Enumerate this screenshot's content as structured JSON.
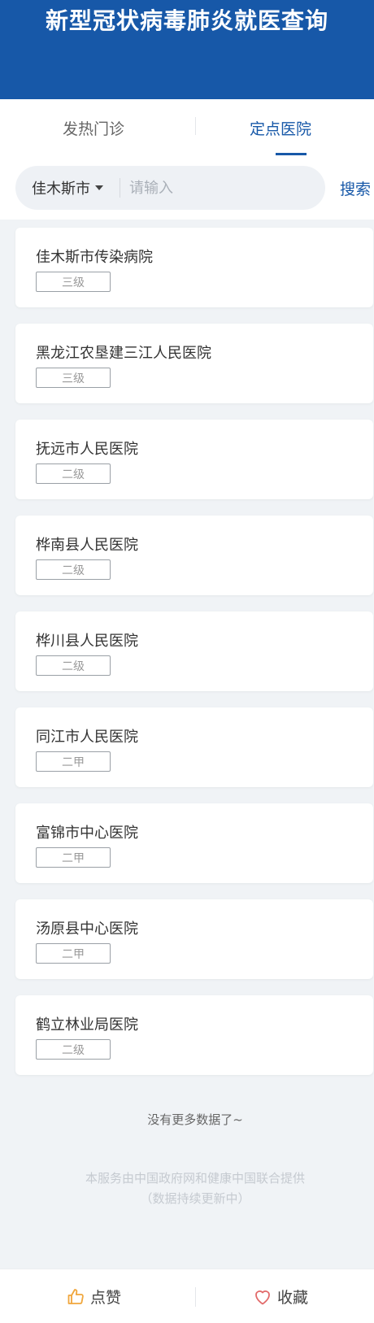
{
  "header": {
    "title": "新型冠状病毒肺炎就医查询"
  },
  "tabs": [
    {
      "label": "发热门诊",
      "active": false
    },
    {
      "label": "定点医院",
      "active": true
    }
  ],
  "search": {
    "city": "佳木斯市",
    "placeholder": "请输入",
    "button_label": "搜索"
  },
  "hospitals": [
    {
      "name": "佳木斯市传染病院",
      "level": "三级"
    },
    {
      "name": "黑龙江农垦建三江人民医院",
      "level": "三级"
    },
    {
      "name": "抚远市人民医院",
      "level": "二级"
    },
    {
      "name": "桦南县人民医院",
      "level": "二级"
    },
    {
      "name": "桦川县人民医院",
      "level": "二级"
    },
    {
      "name": "同江市人民医院",
      "level": "二甲"
    },
    {
      "name": "富锦市中心医院",
      "level": "二甲"
    },
    {
      "name": "汤原县中心医院",
      "level": "二甲"
    },
    {
      "name": "鹤立林业局医院",
      "level": "二级"
    }
  ],
  "list_end_text": "没有更多数据了~",
  "footer": {
    "line1": "本服务由中国政府网和健康中国联合提供",
    "line2": "（数据持续更新中）"
  },
  "bottom_bar": {
    "like_label": "点赞",
    "favorite_label": "收藏"
  },
  "colors": {
    "brand": "#1758a8",
    "like_icon": "#f0a63c",
    "favorite_icon": "#e26a6a"
  },
  "icons": {
    "like": "thumbs-up-icon",
    "favorite": "heart-icon",
    "dropdown": "caret-down-icon"
  }
}
